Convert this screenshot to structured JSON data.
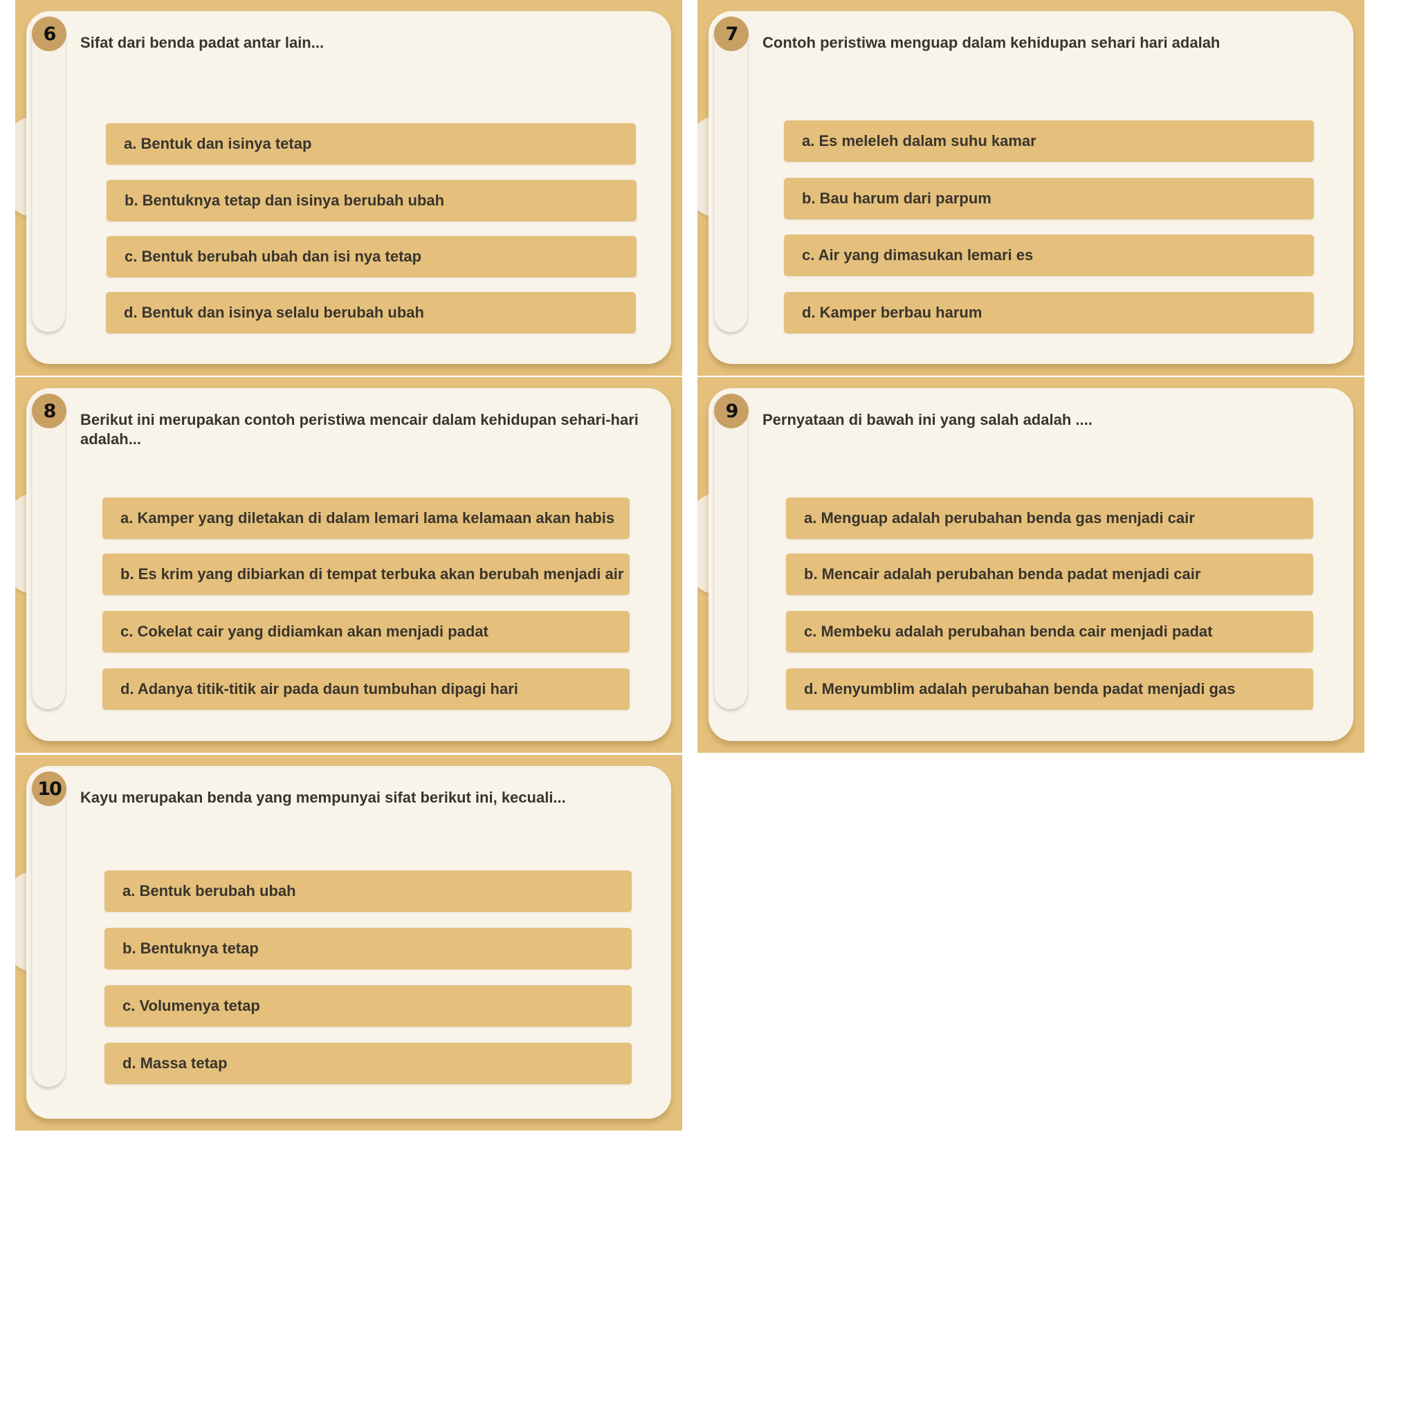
{
  "slides": [
    {
      "number": "6",
      "question": "Sifat dari benda padat antar lain...",
      "options": [
        "a. Bentuk dan isinya tetap",
        "b. Bentuknya tetap dan isinya berubah ubah",
        "c. Bentuk berubah ubah dan isi nya tetap",
        "d. Bentuk dan isinya selalu berubah ubah"
      ]
    },
    {
      "number": "7",
      "question": "Contoh peristiwa menguap dalam kehidupan sehari hari adalah",
      "options": [
        "a.  Es meleleh dalam suhu kamar",
        "b.  Bau harum dari parpum",
        "c.   Air yang dimasukan lemari es",
        "d.  Kamper berbau harum"
      ]
    },
    {
      "number": "8",
      "question": "Berikut ini merupakan contoh peristiwa mencair dalam kehidupan sehari-hari adalah...",
      "options": [
        "a.  Kamper yang diletakan di dalam lemari lama kelamaan akan habis",
        "b.  Es krim yang dibiarkan di tempat terbuka akan berubah menjadi air",
        "c.   Cokelat cair yang didiamkan akan menjadi padat",
        "d.  Adanya titik-titik air pada daun tumbuhan dipagi hari"
      ]
    },
    {
      "number": "9",
      "question": "Pernyataan di bawah ini yang salah adalah ....",
      "options": [
        "a. Menguap adalah perubahan benda gas menjadi cair",
        "b. Mencair adalah perubahan benda padat menjadi cair",
        "c. Membeku adalah perubahan benda cair menjadi padat",
        "d. Menyumblim adalah perubahan benda padat menjadi gas"
      ]
    },
    {
      "number": "10",
      "question": "Kayu merupakan benda yang mempunyai sifat berikut ini, kecuali...",
      "options": [
        "a.  Bentuk berubah ubah",
        "b.  Bentuknya tetap",
        "c.   Volumenya tetap",
        "d.  Massa tetap"
      ]
    }
  ]
}
